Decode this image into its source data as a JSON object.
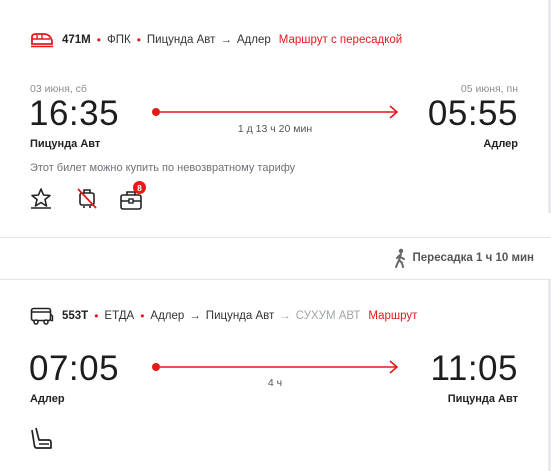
{
  "segment1": {
    "train_number": "471М",
    "carrier": "ФПК",
    "from": "Пицунда Авт",
    "arrow": "→",
    "to": "Адлер",
    "route_link": "Маршрут с пересадкой",
    "dep_date": "03 июня, сб",
    "dep_time": "16:35",
    "dep_city": "Пицунда Авт",
    "arr_date": "05 июня, пн",
    "arr_time": "05:55",
    "arr_city": "Адлер",
    "duration": "1 д 13 ч 20 мин",
    "note": "Этот билет можно купить по невозвратному тарифу",
    "badge_count": "8"
  },
  "transfer": {
    "label": "Пересадка 1 ч 10 мин"
  },
  "segment2": {
    "bus_number": "553Т",
    "carrier": "ЕТДА",
    "from": "Адлер",
    "arrow": "→",
    "via": "Пицунда Авт",
    "arrow2": "→",
    "final": "СУХУМ АВТ",
    "route_link": "Маршрут",
    "dep_time": "07:05",
    "dep_city": "Адлер",
    "arr_time": "11:05",
    "arr_city": "Пицунда Авт",
    "duration": "4 ч"
  },
  "colors": {
    "accent": "#e21a1a",
    "divider": "#e3e5e8",
    "muted": "#8a8f94"
  }
}
